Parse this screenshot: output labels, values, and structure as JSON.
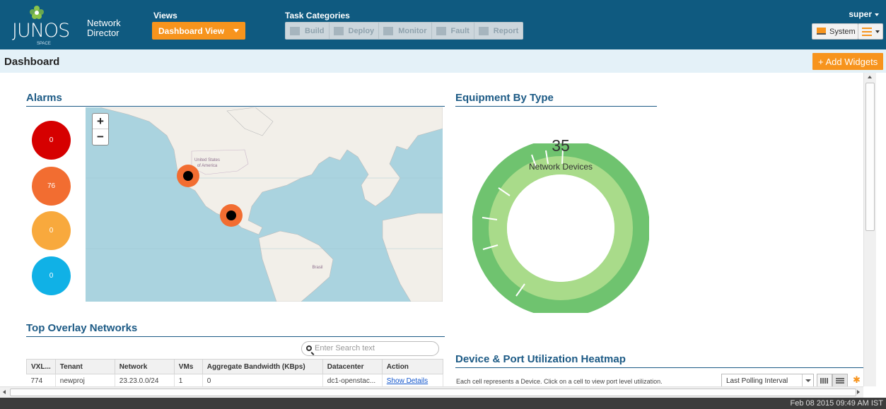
{
  "app": {
    "logo_text": "JUNOS",
    "logo_sub": "SPACE",
    "product_line1": "Network",
    "product_line2": "Director",
    "user": "super"
  },
  "header": {
    "views_label": "Views",
    "views_selected": "Dashboard View",
    "task_label": "Task Categories",
    "tasks": [
      "Build",
      "Deploy",
      "Monitor",
      "Fault",
      "Report"
    ],
    "system_label": "System"
  },
  "page": {
    "title": "Dashboard",
    "add_widgets": "+ Add Widgets"
  },
  "alarms": {
    "title": "Alarms",
    "severity_counts": [
      {
        "value": "0",
        "color": "#d60000"
      },
      {
        "value": "76",
        "color": "#f26d31"
      },
      {
        "value": "0",
        "color": "#f8a93d"
      },
      {
        "value": "0",
        "color": "#10b1e6"
      }
    ],
    "map_labels": {
      "usa_line1": "United States",
      "usa_line2": "of America",
      "brazil": "Brasil"
    },
    "zoom_in": "+",
    "zoom_out": "−"
  },
  "equipment": {
    "title": "Equipment By Type",
    "total": "35",
    "label": "Network Devices",
    "colors": {
      "outer": "#6fc36f",
      "inner": "#a9db8a"
    }
  },
  "overlay_networks": {
    "title": "Top Overlay Networks",
    "search_placeholder": "Enter Search text",
    "columns": [
      "VXL...",
      "Tenant",
      "Network",
      "VMs",
      "Aggregate Bandwidth (KBps)",
      "Datacenter",
      "Action"
    ],
    "rows": [
      [
        "774",
        "newproj",
        "23.23.0.0/24",
        "1",
        "0",
        "dc1-openstac...",
        "Show Details"
      ]
    ]
  },
  "heatmap": {
    "title": "Device & Port Utilization Heatmap",
    "description": "Each cell represents a Device. Click on a cell to view port level utilization.",
    "polling_selected": "Last Polling Interval"
  },
  "status": {
    "datetime": "Feb 08 2015 09:49 AM IST"
  }
}
